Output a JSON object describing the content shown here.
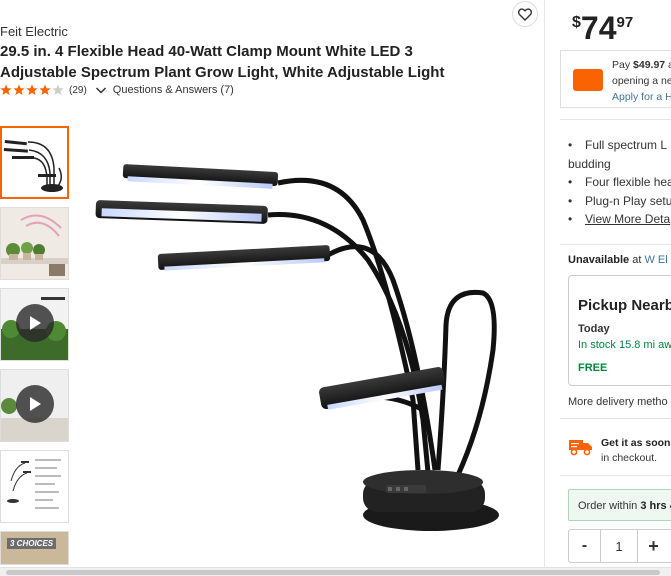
{
  "product": {
    "brand": "Feit Electric",
    "title": "29.5 in. 4 Flexible Head 40-Watt Clamp Mount White LED 3 Adjustable Spectrum Plant Grow Light, White Adjustable Light",
    "rating": 4,
    "review_count": "(29)",
    "qa_link": "Questions & Answers (7)"
  },
  "thumbnails": [
    {
      "name": "lamp-photo",
      "has_video": false
    },
    {
      "name": "plants-shelf",
      "has_video": false
    },
    {
      "name": "video-1",
      "has_video": true
    },
    {
      "name": "video-2",
      "has_video": true
    },
    {
      "name": "spec-diagram",
      "has_video": false
    },
    {
      "name": "choices-banner",
      "label": "3 CHOICES",
      "has_video": false
    }
  ],
  "price": {
    "currency": "$",
    "dollars": "74",
    "cents": "97"
  },
  "promo": {
    "line1_prefix": "Pay ",
    "line1_amount": "$49.97",
    "line1_suffix": " a",
    "line2": "opening a ne",
    "link": "Apply for a H"
  },
  "bullets": [
    "Full spectrum L",
    "budding",
    "Four flexible hea",
    "Plug-n Play setu",
    "View More Deta"
  ],
  "availability": {
    "status": "Unavailable",
    "at": " at ",
    "store": "W El P"
  },
  "pickup": {
    "title": "Pickup Nearb",
    "day": "Today",
    "stock": "In stock 15.8 mi awa",
    "price": "FREE"
  },
  "more_delivery": "More delivery metho",
  "checkout": {
    "line1": "Get it as soon",
    "line2": "in checkout."
  },
  "order": {
    "prefix": "Order within ",
    "time": "3 hrs 4"
  },
  "quantity": {
    "minus": "-",
    "value": "1",
    "plus": "+"
  },
  "colors": {
    "brand_orange": "#f96302",
    "link_blue": "#3e7697",
    "stock_green": "#00873c"
  },
  "icons": [
    "heart-icon",
    "star-icon",
    "chevron-down-icon",
    "play-icon",
    "credit-card-icon",
    "truck-icon"
  ]
}
